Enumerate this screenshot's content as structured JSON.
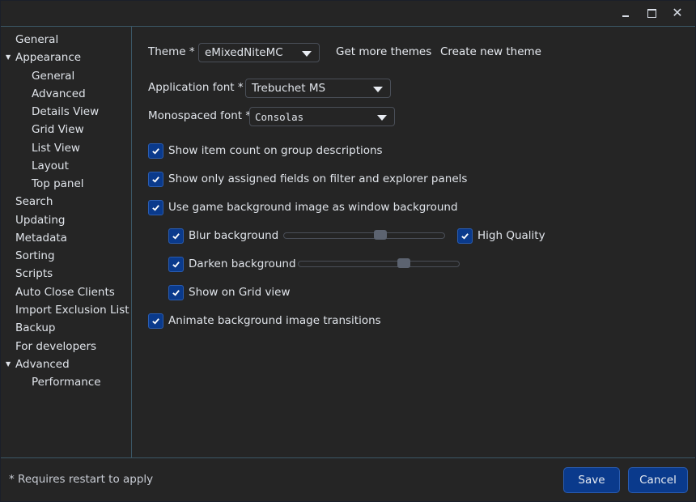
{
  "window": {
    "controls": {
      "minimize": "minimize",
      "maximize": "maximize",
      "close": "close"
    }
  },
  "sidebar": {
    "items": [
      {
        "label": "General",
        "level": 0,
        "expanded": null
      },
      {
        "label": "Appearance",
        "level": 0,
        "expanded": true
      },
      {
        "label": "General",
        "level": 1,
        "expanded": null
      },
      {
        "label": "Advanced",
        "level": 1,
        "expanded": null
      },
      {
        "label": "Details View",
        "level": 1,
        "expanded": null
      },
      {
        "label": "Grid View",
        "level": 1,
        "expanded": null
      },
      {
        "label": "List View",
        "level": 1,
        "expanded": null
      },
      {
        "label": "Layout",
        "level": 1,
        "expanded": null
      },
      {
        "label": "Top panel",
        "level": 1,
        "expanded": null
      },
      {
        "label": "Search",
        "level": 0,
        "expanded": null
      },
      {
        "label": "Updating",
        "level": 0,
        "expanded": null
      },
      {
        "label": "Metadata",
        "level": 0,
        "expanded": null
      },
      {
        "label": "Sorting",
        "level": 0,
        "expanded": null
      },
      {
        "label": "Scripts",
        "level": 0,
        "expanded": null
      },
      {
        "label": "Auto Close Clients",
        "level": 0,
        "expanded": null
      },
      {
        "label": "Import Exclusion List",
        "level": 0,
        "expanded": null
      },
      {
        "label": "Backup",
        "level": 0,
        "expanded": null
      },
      {
        "label": "For developers",
        "level": 0,
        "expanded": null
      },
      {
        "label": "Advanced",
        "level": 0,
        "expanded": true
      },
      {
        "label": "Performance",
        "level": 1,
        "expanded": null
      }
    ]
  },
  "main": {
    "theme": {
      "label": "Theme *",
      "value": "eMixedNiteMC",
      "get_more": "Get more themes",
      "create_new": "Create new theme"
    },
    "app_font": {
      "label": "Application font *",
      "value": "Trebuchet MS"
    },
    "mono_font": {
      "label": "Monospaced font *",
      "value": "Consolas"
    },
    "checks": {
      "item_count": {
        "label": "Show item count on group descriptions",
        "checked": true
      },
      "assigned_fields": {
        "label": "Show only assigned fields on filter and explorer panels",
        "checked": true
      },
      "use_bg": {
        "label": "Use game background image as window background",
        "checked": true
      },
      "blur": {
        "label": "Blur background",
        "checked": true
      },
      "high_quality": {
        "label": "High Quality",
        "checked": true
      },
      "darken": {
        "label": "Darken background",
        "checked": true
      },
      "grid_view": {
        "label": "Show on Grid view",
        "checked": true
      },
      "animate": {
        "label": "Animate background image transitions",
        "checked": true
      }
    },
    "sliders": {
      "blur_value": 0.61,
      "darken_value": 0.67
    }
  },
  "footer": {
    "note": "* Requires restart to apply",
    "save": "Save",
    "cancel": "Cancel"
  },
  "colors": {
    "accent": "#0a3a8c",
    "background": "#252525",
    "divider": "#3b5766",
    "text": "#e0e4ea"
  }
}
